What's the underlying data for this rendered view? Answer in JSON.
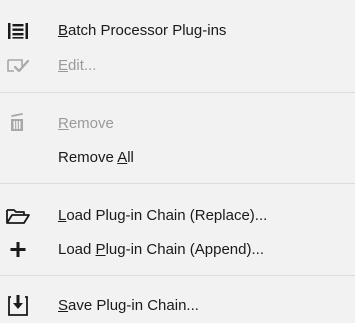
{
  "menu": {
    "items": [
      {
        "id": "batch",
        "pre": "",
        "mn": "B",
        "post": "atch Processor Plug-ins",
        "enabled": true,
        "icon": "batch-list-icon"
      },
      {
        "id": "edit",
        "pre": "",
        "mn": "E",
        "post": "dit...",
        "enabled": false,
        "icon": "edit-check-icon"
      },
      {
        "id": "remove",
        "pre": "",
        "mn": "R",
        "post": "emove",
        "enabled": false,
        "icon": "trash-icon"
      },
      {
        "id": "removeall",
        "pre": "Remove ",
        "mn": "A",
        "post": "ll",
        "enabled": true,
        "icon": ""
      },
      {
        "id": "loadrep",
        "pre": "",
        "mn": "L",
        "post": "oad Plug-in Chain (Replace)...",
        "enabled": true,
        "icon": "folder-open-icon"
      },
      {
        "id": "loadapp",
        "pre": "Load ",
        "mn": "P",
        "post": "lug-in Chain (Append)...",
        "enabled": true,
        "icon": "plus-icon"
      },
      {
        "id": "save",
        "pre": "",
        "mn": "S",
        "post": "ave Plug-in Chain...",
        "enabled": true,
        "icon": "save-download-icon"
      }
    ]
  },
  "colors": {
    "background": "#f2f2f2",
    "text": "#1a1a1a",
    "disabled_text": "#9a9a9a",
    "separator": "#dcdcdc"
  }
}
